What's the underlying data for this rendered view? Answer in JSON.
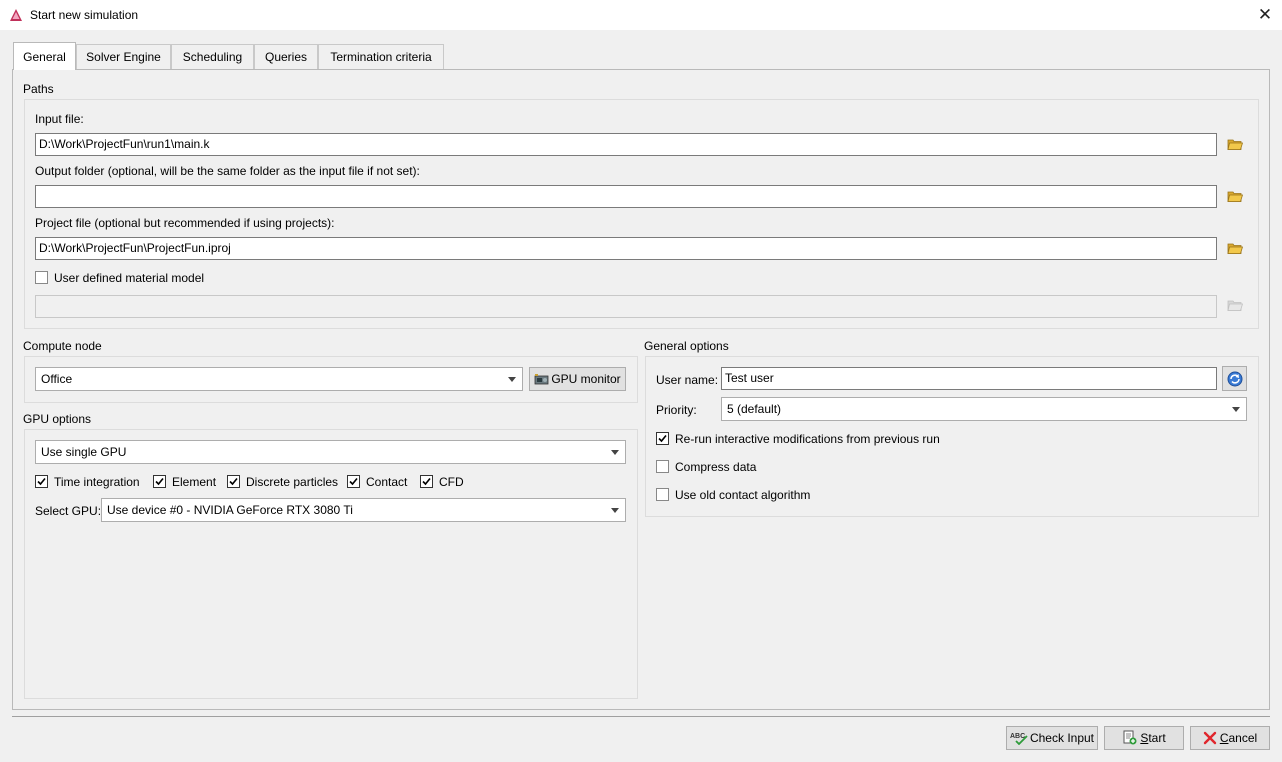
{
  "window": {
    "title": "Start new simulation",
    "close_symbol": "✕"
  },
  "tabs": [
    "General",
    "Solver Engine",
    "Scheduling",
    "Queries",
    "Termination criteria"
  ],
  "paths": {
    "heading": "Paths",
    "input_file_label": "Input file:",
    "input_file_value": "D:\\Work\\ProjectFun\\run1\\main.k",
    "output_folder_label": "Output folder (optional, will be the same folder as the input file if not set):",
    "output_folder_value": "",
    "project_file_label": "Project file (optional but recommended if using projects):",
    "project_file_value": "D:\\Work\\ProjectFun\\ProjectFun.iproj",
    "user_material_label": "User defined material model",
    "user_material_checked": false,
    "user_material_value": ""
  },
  "compute_node": {
    "heading": "Compute node",
    "selected": "Office",
    "gpu_monitor_label": "GPU monitor"
  },
  "gpu_options": {
    "heading": "GPU options",
    "mode_selected": "Use single GPU",
    "checks": [
      {
        "label": "Time integration",
        "checked": true
      },
      {
        "label": "Element",
        "checked": true
      },
      {
        "label": "Discrete particles",
        "checked": true
      },
      {
        "label": "Contact",
        "checked": true
      },
      {
        "label": "CFD",
        "checked": true
      }
    ],
    "select_gpu_label": "Select GPU:",
    "select_gpu_value": "Use device #0 - NVIDIA GeForce RTX 3080 Ti"
  },
  "general_options": {
    "heading": "General options",
    "user_name_label": "User name:",
    "user_name_value": "Test user",
    "priority_label": "Priority:",
    "priority_value": "5 (default)",
    "rerun_label": "Re-run interactive modifications from previous run",
    "rerun_checked": true,
    "compress_label": "Compress data",
    "compress_checked": false,
    "old_contact_label": "Use old contact algorithm",
    "old_contact_checked": false
  },
  "footer": {
    "check_input_label": "Check Input",
    "start_prefix": "",
    "start_mnemonic": "S",
    "start_rest": "tart",
    "cancel_mnemonic": "C",
    "cancel_rest": "ancel"
  },
  "colors": {
    "accent_red": "#e0262c",
    "folder_yellow": "#f2c84b",
    "dialog_bg": "#f0f0f0"
  },
  "icons": {
    "app": "app-triangle-icon",
    "folder": "folder-open-icon",
    "gpu": "gpu-card-icon",
    "refresh": "refresh-user-icon",
    "check_input": "spellcheck-icon",
    "start": "start-run-icon",
    "cancel": "cancel-x-icon"
  }
}
